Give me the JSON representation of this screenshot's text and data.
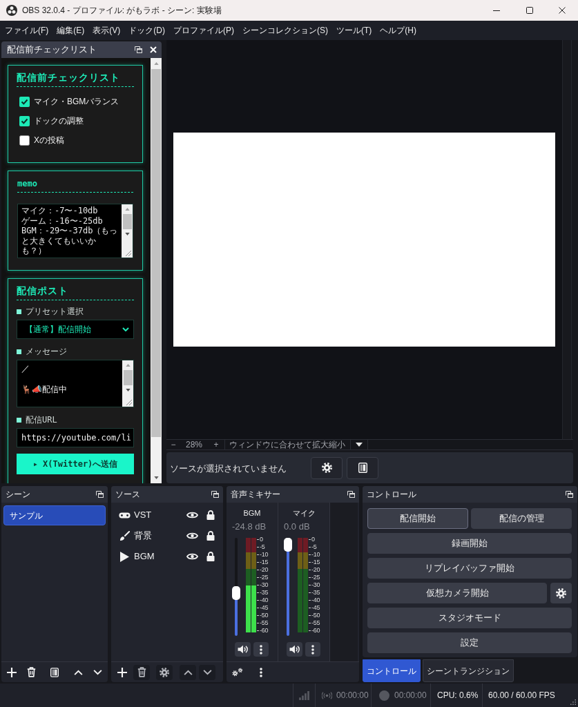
{
  "window": {
    "title": "OBS 32.0.4 - プロファイル: がもラボ - シーン: 実験場"
  },
  "menu": [
    "ファイル(F)",
    "編集(E)",
    "表示(V)",
    "ドック(D)",
    "プロファイル(P)",
    "シーンコレクション(S)",
    "ツール(T)",
    "ヘルプ(H)"
  ],
  "checklist_dock": {
    "title": "配信前チェックリスト",
    "checklist": {
      "title": "配信前チェックリスト",
      "items": [
        {
          "label": "マイク・BGMバランス",
          "checked": true
        },
        {
          "label": "ドックの調整",
          "checked": true
        },
        {
          "label": "Xの投稿",
          "checked": false
        }
      ]
    },
    "memo": {
      "title": "memo",
      "value": "マイク：-7〜-10db\nゲーム：-16〜-25db\nBGM：-29〜-37db（もっと大きくてもいいかも？）"
    },
    "post": {
      "title": "配信ポスト",
      "fields": [
        {
          "kind": "select",
          "label": "プリセット選択",
          "value": "【通常】配信開始"
        },
        {
          "kind": "textarea",
          "label": "メッセージ",
          "value": "／\n\n🦌📣配信中"
        },
        {
          "kind": "input",
          "label": "配信URL",
          "value": "https://youtube.com/li"
        }
      ],
      "send_button": "▸ X(Twitter)へ送信"
    }
  },
  "preview": {
    "zoom_out": "−",
    "zoom": "28%",
    "zoom_in": "+",
    "fit_mode": "ウィンドウに合わせて拡大縮小"
  },
  "source_toolbar": {
    "message": "ソースが選択されていません"
  },
  "scenes": {
    "title": "シーン",
    "items": [
      {
        "name": "サンプル",
        "selected": true
      }
    ],
    "toolbar": [
      {
        "kind": "add",
        "disabled": false
      },
      {
        "kind": "remove",
        "disabled": false
      },
      {
        "kind": "filters",
        "disabled": false
      },
      {
        "kind": "move_up",
        "disabled": false
      },
      {
        "kind": "move_down",
        "disabled": false
      }
    ]
  },
  "sources": {
    "title": "ソース",
    "items": [
      {
        "name": "VST",
        "kind": "gamepad",
        "visible": true,
        "locked": true
      },
      {
        "name": "背景",
        "kind": "brush",
        "visible": true,
        "locked": true
      },
      {
        "name": "BGM",
        "kind": "media",
        "visible": true,
        "locked": true
      }
    ],
    "toolbar": [
      {
        "kind": "add",
        "disabled": false
      },
      {
        "kind": "remove",
        "disabled": true
      },
      {
        "kind": "properties",
        "disabled": true
      },
      {
        "kind": "move_up",
        "disabled": true
      },
      {
        "kind": "move_down",
        "disabled": true
      }
    ]
  },
  "mixer": {
    "title": "音声ミキサー",
    "channels": [
      {
        "name": "BGM",
        "reading": "-24.8 dB",
        "level": 0.43,
        "meter": [
          {
            "level": 0.5
          },
          {
            "level": 0.5
          }
        ],
        "scale": [
          "0",
          "-5",
          "-10",
          "-15",
          "-20",
          "-25",
          "-30",
          "-35",
          "-40",
          "-45",
          "-50",
          "-55",
          "-60"
        ],
        "muted": false
      },
      {
        "name": "マイク",
        "reading": "0.0 dB",
        "level": 1,
        "scale": [
          "0",
          "-5",
          "-10",
          "-15",
          "-20",
          "-25",
          "-30",
          "-35",
          "-40",
          "-45",
          "-50",
          "-55",
          "-60"
        ],
        "muted": false
      }
    ]
  },
  "controls": {
    "title": "コントロール",
    "rows": [
      [
        {
          "kind": "text",
          "label": "配信開始",
          "focused": true
        },
        {
          "kind": "text",
          "label": "配信の管理",
          "focused": false
        }
      ],
      [
        {
          "kind": "text",
          "label": "録画開始",
          "focused": false
        }
      ],
      [
        {
          "kind": "text",
          "label": "リプレイバッファ開始",
          "focused": false
        }
      ],
      [
        {
          "kind": "text",
          "label": "仮想カメラ開始",
          "focused": false
        },
        {
          "kind": "settings"
        }
      ],
      [
        {
          "kind": "text",
          "label": "スタジオモード",
          "focused": false
        }
      ],
      [
        {
          "kind": "text",
          "label": "設定",
          "focused": false
        }
      ]
    ],
    "tabs": [
      {
        "label": "コントロール",
        "selected": true
      },
      {
        "label": "シーントランジション",
        "selected": false
      }
    ]
  },
  "status_bar": {
    "stream_time": "00:00:00",
    "record_time": "00:00:00",
    "cpu": "CPU: 0.6%",
    "fps": "60.00 / 60.00 FPS"
  }
}
